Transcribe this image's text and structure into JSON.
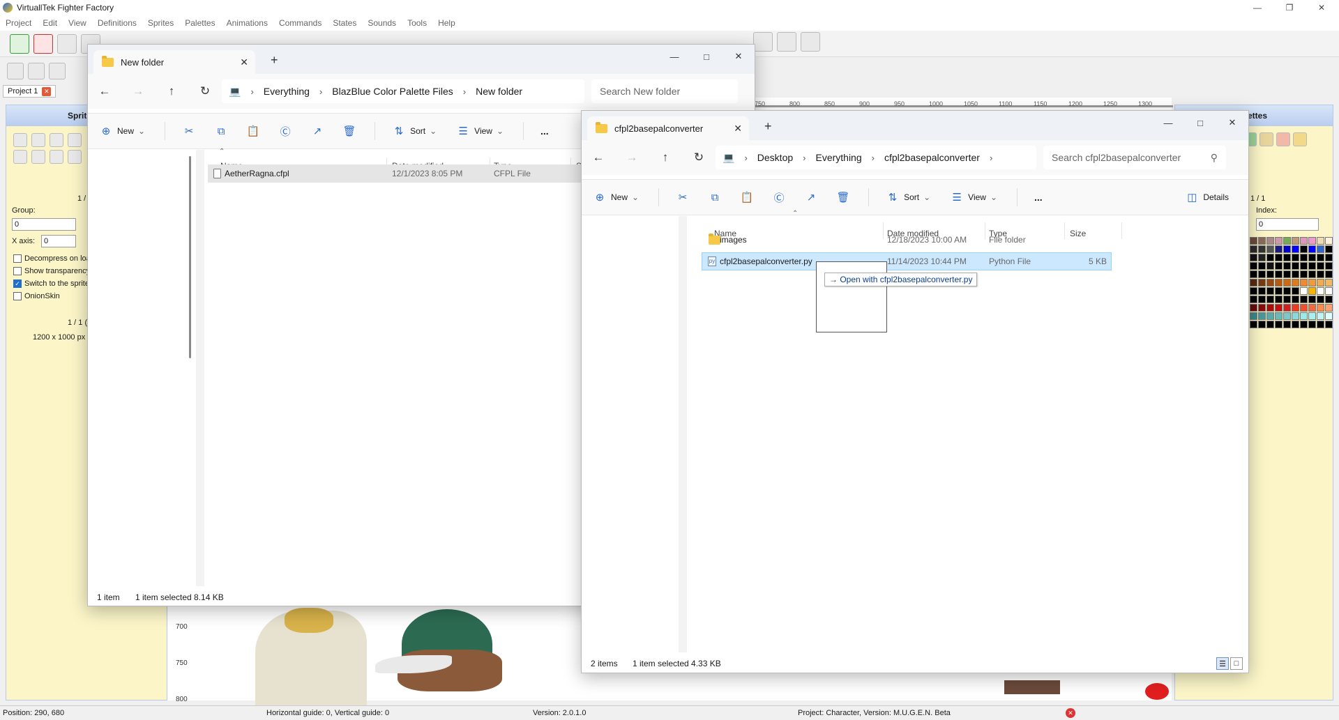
{
  "ff": {
    "title": "VirtuallTek Fighter Factory",
    "menu": [
      "Project",
      "Edit",
      "View",
      "Definitions",
      "Sprites",
      "Palettes",
      "Animations",
      "Commands",
      "States",
      "Sounds",
      "Tools",
      "Help"
    ],
    "project_tab": "Project 1",
    "sprites_panel": {
      "header": "Sprit",
      "page": "1 /",
      "group_label": "Group:",
      "group_value": "0",
      "xaxis_label": "X axis:",
      "xaxis_value": "0",
      "checkbox_decompress": "Decompress on loa",
      "checkbox_transparency": "Show transparency",
      "checkbox_switch": "Switch to the sprite",
      "checkbox_onionskin": "OnionSkin",
      "count": "1 / 1 (",
      "size": "1200 x 1000 px"
    },
    "palettes_panel": {
      "header": "ettes",
      "page": "1 / 1",
      "index_label": "Index:",
      "index_value": "0"
    },
    "ruler_top": [
      "750",
      "800",
      "850",
      "900",
      "950",
      "1000",
      "1050",
      "1100",
      "1150",
      "1200",
      "1250",
      "1300"
    ],
    "ruler_left": [
      "700",
      "750",
      "800"
    ],
    "status": {
      "position": "Position: 290, 680",
      "guides": "Horizontal guide: 0, Vertical guide: 0",
      "version": "Version: 2.0.1.0",
      "project": "Project: Character, Version: M.U.G.E.N. Beta"
    },
    "colors": {
      "panel_bg": "#fbf5c8",
      "panel_header": "#c4d6f2"
    }
  },
  "explorer1": {
    "tab_title": "New folder",
    "breadcrumb": [
      "Everything",
      "BlazBlue Color Palette Files",
      "New folder"
    ],
    "search_placeholder": "Search New folder",
    "commands": {
      "new": "New",
      "sort": "Sort",
      "view": "View",
      "more": "..."
    },
    "columns": {
      "name": "Name",
      "date": "Date modified",
      "type": "Type",
      "size": "Si"
    },
    "files": [
      {
        "name": "AetherRagna.cfpl",
        "date": "12/1/2023 8:05 PM",
        "type": "CFPL File",
        "selected": true
      }
    ],
    "status": {
      "items": "1 item",
      "selected": "1 item selected  8.14 KB"
    }
  },
  "explorer2": {
    "tab_title": "cfpl2basepalconverter",
    "breadcrumb": [
      "Desktop",
      "Everything",
      "cfpl2basepalconverter"
    ],
    "search_placeholder": "Search cfpl2basepalconverter",
    "commands": {
      "new": "New",
      "sort": "Sort",
      "view": "View",
      "more": "...",
      "details": "Details"
    },
    "columns": {
      "name": "Name",
      "date": "Date modified",
      "type": "Type",
      "size": "Size"
    },
    "files": [
      {
        "name": "images",
        "date": "12/18/2023 10:00 AM",
        "type": "File folder",
        "size": ""
      },
      {
        "name": "cfpl2basepalconverter.py",
        "date": "11/14/2023 10:44 PM",
        "type": "Python File",
        "size": "5 KB"
      }
    ],
    "drag_tip": "Open with cfpl2basepalconverter.py",
    "status": {
      "items": "2 items",
      "selected": "1 item selected  4.33 KB"
    }
  }
}
